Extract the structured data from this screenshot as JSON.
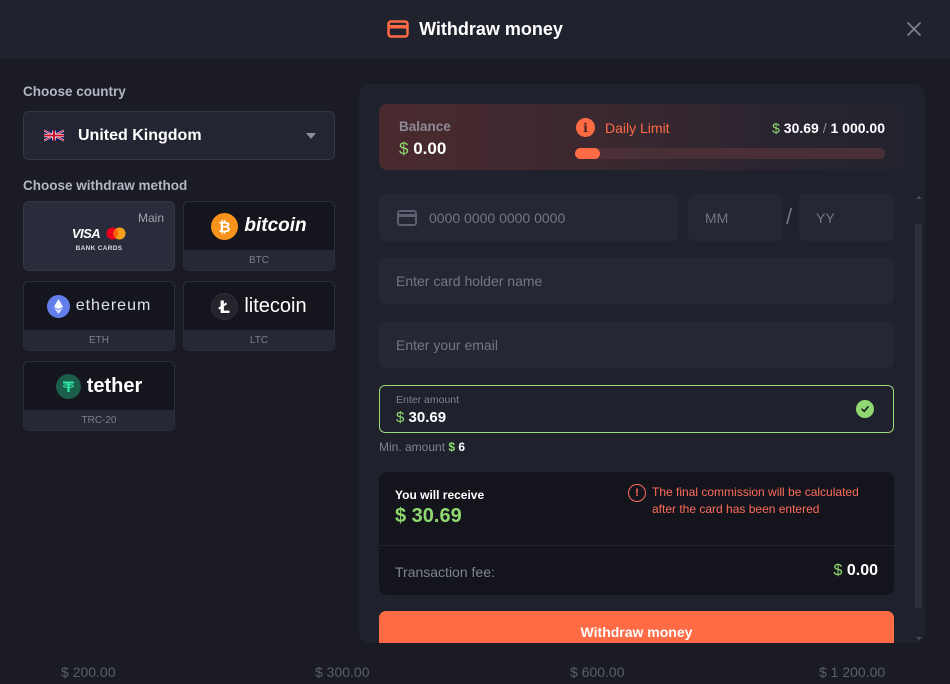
{
  "header": {
    "title": "Withdraw money",
    "icon": "credit-card-icon",
    "close_icon": "close-icon"
  },
  "left": {
    "country_label": "Choose country",
    "country": {
      "name": "United Kingdom",
      "flag": "uk-flag-icon"
    },
    "method_label": "Choose withdraw method",
    "methods": [
      {
        "id": "bank-cards",
        "logo_text": "VISA",
        "caption": "BANK CARDS",
        "tag": "Main",
        "active": true
      },
      {
        "id": "bitcoin",
        "logo_text": "bitcoin",
        "sub": "BTC",
        "active": false
      },
      {
        "id": "ethereum",
        "logo_text": "ethereum",
        "sub": "ETH",
        "active": false
      },
      {
        "id": "litecoin",
        "logo_text": "litecoin",
        "sub": "LTC",
        "active": false
      },
      {
        "id": "tether",
        "logo_text": "tether",
        "sub": "TRC-20",
        "active": false
      }
    ]
  },
  "balance": {
    "label": "Balance",
    "currency": "$",
    "value": "0.00",
    "daily_limit_label": "Daily Limit",
    "daily_used": "30.69",
    "daily_max": "1 000.00",
    "daily_sep": "/",
    "daily_progress_fraction": 0.031
  },
  "form": {
    "card_number_placeholder": "0000 0000 0000 0000",
    "mm_placeholder": "MM",
    "slash": "/",
    "yy_placeholder": "YY",
    "holder_placeholder": "Enter card holder name",
    "email_placeholder": "Enter your email",
    "amount_label": "Enter amount",
    "amount_currency": "$",
    "amount_value": "30.69",
    "min_amount_label": "Min. amount",
    "min_amount_currency": "$",
    "min_amount_value": "6"
  },
  "summary": {
    "receive_label": "You will receive",
    "receive_value": "$ 30.69",
    "warning_text": "The final commission will be calculated after the card has been entered",
    "fee_label": "Transaction fee:",
    "fee_currency": "$",
    "fee_value": "0.00"
  },
  "withdraw_button": "Withdraw money",
  "bottom_amounts": [
    "$ 200.00",
    "$ 300.00",
    "$ 600.00",
    "$ 1 200.00"
  ],
  "colors": {
    "accent": "#ff6b45",
    "success": "#8fd970",
    "background": "#1a1b23",
    "panel": "#1f212c"
  }
}
